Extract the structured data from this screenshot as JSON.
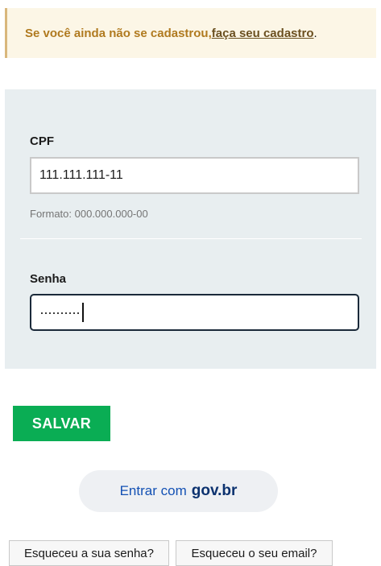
{
  "alert": {
    "text": "Se você ainda não se cadastrou, ",
    "link_label": "faça seu cadastro",
    "trailing": "."
  },
  "form": {
    "cpf": {
      "label": "CPF",
      "value": "111.111.111-11",
      "hint": "Formato: 000.000.000-00"
    },
    "password": {
      "label": "Senha",
      "masked_value": "··········"
    }
  },
  "actions": {
    "save_label": "SALVAR",
    "govbr_prefix": "Entrar com ",
    "govbr_brand": "gov.br",
    "forgot_password_label": "Esqueceu a sua senha?",
    "forgot_email_label": "Esqueceu o seu email?"
  },
  "colors": {
    "alert_bg": "#fcf6e6",
    "alert_text": "#b07a1f",
    "panel_bg": "#e8eef0",
    "save_green": "#0aad54",
    "govbr_blue": "#1351b4"
  }
}
